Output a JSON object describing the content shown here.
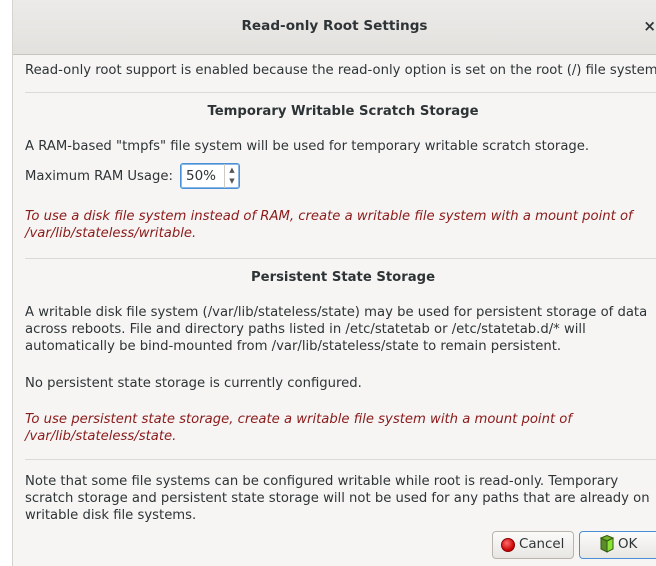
{
  "dialog": {
    "title": "Read-only Root Settings",
    "close_glyph": "×"
  },
  "intro": "Read-only root support is enabled because the read-only option is set on the root (/) file system.",
  "scratch": {
    "heading": "Temporary Writable Scratch Storage",
    "description": "A RAM-based \"tmpfs\" file system will be used for temporary writable scratch storage.",
    "max_ram_label": "Maximum RAM Usage:",
    "max_ram_value": "50%",
    "warning": "To use a disk file system instead of RAM, create a writable file system with a mount point of /var/lib/stateless/writable."
  },
  "persistent": {
    "heading": "Persistent State Storage",
    "description": "A writable disk file system (/var/lib/stateless/state) may be used for persistent storage of data across reboots.  File and directory paths listed in /etc/statetab or /etc/statetab.d/* will automatically be bind-mounted from /var/lib/stateless/state to remain persistent.",
    "status": "No persistent state storage is currently configured.",
    "warning": "To use persistent state storage, create a writable file system with a mount point of /var/lib/stateless/state."
  },
  "note": "Note that some file systems can be configured writable while root is read-only.  Temporary scratch storage and persistent state storage will not be used for any paths that are already on writable disk file systems.",
  "buttons": {
    "cancel_label": "Cancel",
    "ok_label": "OK"
  },
  "icons": {
    "cancel": "cancel-icon",
    "ok": "ok-icon",
    "spin_up": "spin-up-icon",
    "spin_down": "spin-down-icon"
  },
  "colors": {
    "warning_text": "#8b1a1a",
    "focus_border": "#4a90d9",
    "cancel_red": "#c80000",
    "ok_green": "#4e9a06"
  }
}
